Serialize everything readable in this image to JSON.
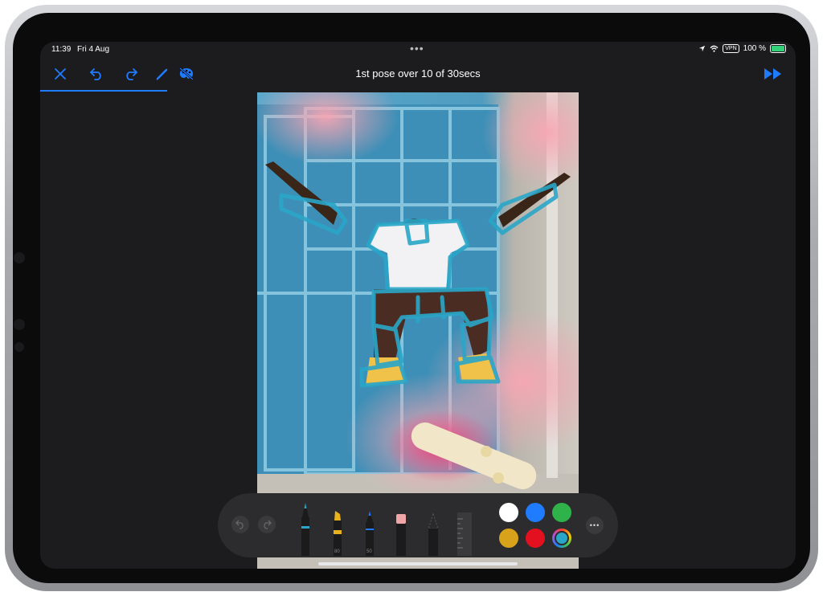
{
  "status": {
    "time": "11:39",
    "date": "Fri 4 Aug",
    "vpn": "VPN",
    "battery": "100 %"
  },
  "toolbar": {
    "title": "1st pose over 10 of 30secs",
    "icons": [
      "close-icon",
      "undo-icon",
      "redo-icon",
      "pencil-icon",
      "palette-hidden-icon",
      "fast-forward-icon"
    ],
    "accent": "#1f7cff"
  },
  "tools": {
    "marker_size": "80",
    "pencil_size": "50"
  },
  "colors": {
    "swatches": [
      "#ffffff",
      "#1f7cff",
      "#2fb24a",
      "#d8a31a",
      "#e3101f"
    ],
    "stroke": "#2aa6c8"
  }
}
